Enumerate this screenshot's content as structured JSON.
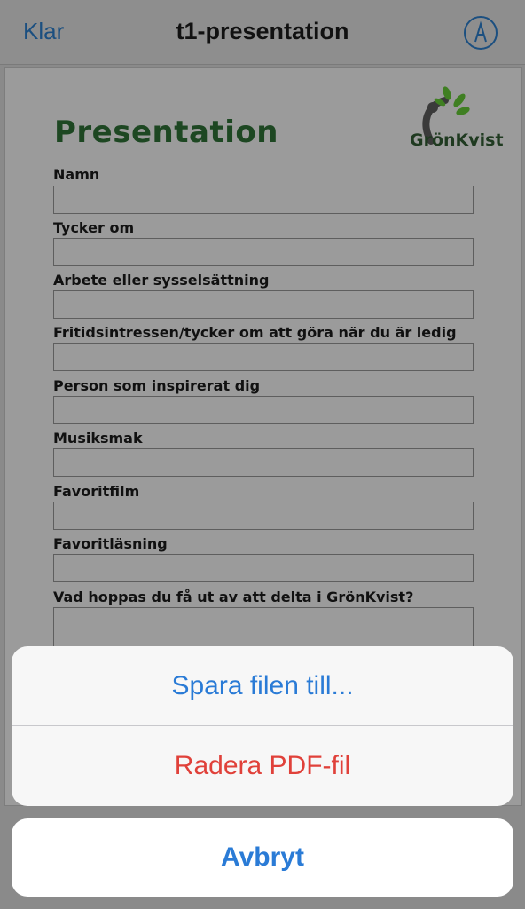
{
  "nav": {
    "back_label": "Klar",
    "title": "t1-presentation",
    "markup_icon": "markup-pen-icon"
  },
  "document": {
    "heading": "Presentation",
    "logo_text": "GrönKvist",
    "fields": [
      {
        "label": "Namn"
      },
      {
        "label": "Tycker om"
      },
      {
        "label": "Arbete eller sysselsättning"
      },
      {
        "label": "Fritidsintressen/tycker om att göra när du är ledig"
      },
      {
        "label": "Person som inspirerat dig"
      },
      {
        "label": "Musiksmak"
      },
      {
        "label": "Favoritfilm"
      },
      {
        "label": "Favoritläsning"
      },
      {
        "label": "Vad hoppas du få ut av att delta i GrönKvist?"
      }
    ]
  },
  "action_sheet": {
    "save_label": "Spara filen till...",
    "delete_label": "Radera PDF-fil",
    "cancel_label": "Avbryt"
  },
  "colors": {
    "accent_blue": "#2a7bd6",
    "destructive_red": "#e0413a",
    "heading_green": "#1d4722"
  }
}
